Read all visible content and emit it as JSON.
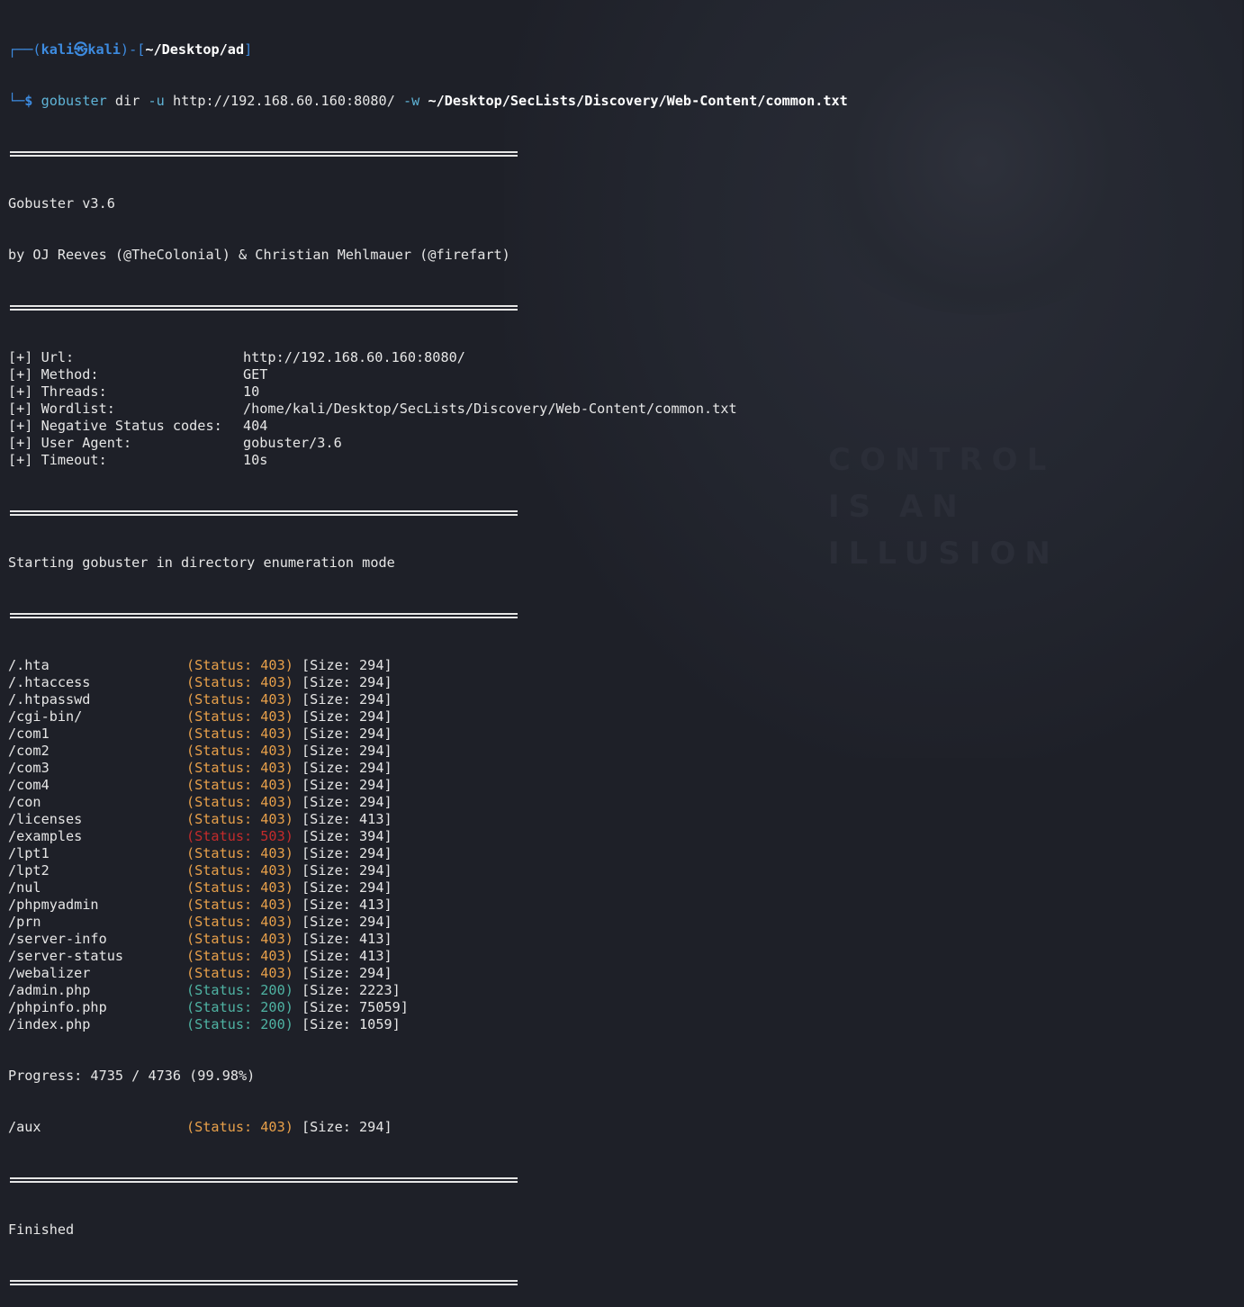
{
  "prompt": {
    "corner_top": "┌──(",
    "user": "kali",
    "at": "㉿",
    "host": "kali",
    "close_paren": ")-[",
    "cwd": "~/Desktop/ad",
    "close_bracket": "]",
    "corner_bottom": "└─",
    "dollar": "$",
    "cmd": "gobuster",
    "arg1": "dir",
    "flag_u": "-u",
    "url": "http://192.168.60.160:8080/",
    "flag_w": "-w",
    "wordlist": "~/Desktop/SecLists/Discovery/Web-Content/common.txt"
  },
  "banner": {
    "version": "Gobuster v3.6",
    "authors": "by OJ Reeves (@TheColonial) & Christian Mehlmauer (@firefart)"
  },
  "config": [
    {
      "label": "[+] Url:",
      "value": "http://192.168.60.160:8080/"
    },
    {
      "label": "[+] Method:",
      "value": "GET"
    },
    {
      "label": "[+] Threads:",
      "value": "10"
    },
    {
      "label": "[+] Wordlist:",
      "value": "/home/kali/Desktop/SecLists/Discovery/Web-Content/common.txt"
    },
    {
      "label": "[+] Negative Status codes:",
      "value": "404"
    },
    {
      "label": "[+] User Agent:",
      "value": "gobuster/3.6"
    },
    {
      "label": "[+] Timeout:",
      "value": "10s"
    }
  ],
  "start_msg": "Starting gobuster in directory enumeration mode",
  "results": [
    {
      "path": "/.hta",
      "status": "(Status: 403)",
      "size": "[Size: 294]",
      "color": "#e8a04a"
    },
    {
      "path": "/.htaccess",
      "status": "(Status: 403)",
      "size": "[Size: 294]",
      "color": "#e8a04a"
    },
    {
      "path": "/.htpasswd",
      "status": "(Status: 403)",
      "size": "[Size: 294]",
      "color": "#e8a04a"
    },
    {
      "path": "/cgi-bin/",
      "status": "(Status: 403)",
      "size": "[Size: 294]",
      "color": "#e8a04a"
    },
    {
      "path": "/com1",
      "status": "(Status: 403)",
      "size": "[Size: 294]",
      "color": "#e8a04a"
    },
    {
      "path": "/com2",
      "status": "(Status: 403)",
      "size": "[Size: 294]",
      "color": "#e8a04a"
    },
    {
      "path": "/com3",
      "status": "(Status: 403)",
      "size": "[Size: 294]",
      "color": "#e8a04a"
    },
    {
      "path": "/com4",
      "status": "(Status: 403)",
      "size": "[Size: 294]",
      "color": "#e8a04a"
    },
    {
      "path": "/con",
      "status": "(Status: 403)",
      "size": "[Size: 294]",
      "color": "#e8a04a"
    },
    {
      "path": "/licenses",
      "status": "(Status: 403)",
      "size": "[Size: 413]",
      "color": "#e8a04a"
    },
    {
      "path": "/examples",
      "status": "(Status: 503)",
      "size": "[Size: 394]",
      "color": "#c42b2b"
    },
    {
      "path": "/lpt1",
      "status": "(Status: 403)",
      "size": "[Size: 294]",
      "color": "#e8a04a"
    },
    {
      "path": "/lpt2",
      "status": "(Status: 403)",
      "size": "[Size: 294]",
      "color": "#e8a04a"
    },
    {
      "path": "/nul",
      "status": "(Status: 403)",
      "size": "[Size: 294]",
      "color": "#e8a04a"
    },
    {
      "path": "/phpmyadmin",
      "status": "(Status: 403)",
      "size": "[Size: 413]",
      "color": "#e8a04a"
    },
    {
      "path": "/prn",
      "status": "(Status: 403)",
      "size": "[Size: 294]",
      "color": "#e8a04a"
    },
    {
      "path": "/server-info",
      "status": "(Status: 403)",
      "size": "[Size: 413]",
      "color": "#e8a04a"
    },
    {
      "path": "/server-status",
      "status": "(Status: 403)",
      "size": "[Size: 413]",
      "color": "#e8a04a"
    },
    {
      "path": "/webalizer",
      "status": "(Status: 403)",
      "size": "[Size: 294]",
      "color": "#e8a04a"
    },
    {
      "path": "/admin.php",
      "status": "(Status: 200)",
      "size": "[Size: 2223]",
      "color": "#4fb3a3"
    },
    {
      "path": "/phpinfo.php",
      "status": "(Status: 200)",
      "size": "[Size: 75059]",
      "color": "#4fb3a3"
    },
    {
      "path": "/index.php",
      "status": "(Status: 200)",
      "size": "[Size: 1059]",
      "color": "#4fb3a3"
    }
  ],
  "progress": "Progress: 4735 / 4736 (99.98%)",
  "last_result": {
    "path": "/aux",
    "status": "(Status: 403)",
    "size": "[Size: 294]",
    "color": "#e8a04a"
  },
  "finished": "Finished",
  "wallpaper_text": "CONTROL\nIS AN\nILLUSION"
}
